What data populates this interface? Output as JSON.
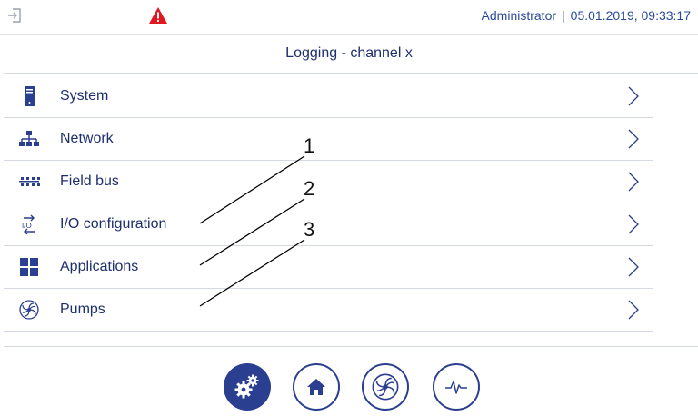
{
  "header": {
    "user": "Administrator",
    "separator": "|",
    "datetime": "05.01.2019, 09:33:17",
    "alarm_color": "#e0171f"
  },
  "page_title": "Logging - channel x",
  "menu": {
    "items": [
      {
        "label": "System",
        "icon": "server-icon"
      },
      {
        "label": "Network",
        "icon": "network-icon"
      },
      {
        "label": "Field bus",
        "icon": "fieldbus-icon"
      },
      {
        "label": "I/O configuration",
        "icon": "io-icon"
      },
      {
        "label": "Applications",
        "icon": "grid-icon"
      },
      {
        "label": "Pumps",
        "icon": "pump-icon"
      }
    ]
  },
  "callouts": [
    "1",
    "2",
    "3"
  ],
  "bottom_nav": [
    {
      "name": "settings",
      "icon": "gears-icon",
      "active": true
    },
    {
      "name": "home",
      "icon": "home-icon",
      "active": false
    },
    {
      "name": "pumps",
      "icon": "pump-icon",
      "active": false
    },
    {
      "name": "trend",
      "icon": "trend-icon",
      "active": false
    }
  ],
  "colors": {
    "accent": "#2a3f8f",
    "text": "#1e2f6e",
    "divider": "#d5d9e1"
  }
}
